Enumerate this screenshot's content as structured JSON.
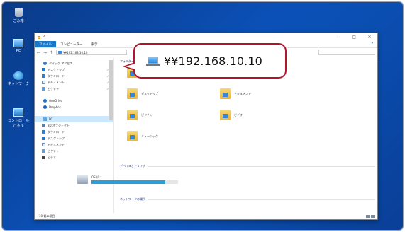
{
  "desktop": {
    "icons": [
      {
        "label": "ごみ箱",
        "icon": "recycle-bin-icon"
      },
      {
        "label": "PC",
        "icon": "pc-icon"
      },
      {
        "label": "ネットワーク",
        "icon": "network-icon"
      },
      {
        "label": "コントロールパネル",
        "icon": "control-panel-icon"
      }
    ]
  },
  "explorer": {
    "window_title": "PC",
    "window_buttons": [
      "—",
      "□",
      "×"
    ],
    "ribbon_tabs": [
      "ファイル",
      "コンピューター",
      "表示"
    ],
    "address_path": "¥¥192.168.10.10",
    "sidebar": [
      {
        "label": "クイック アクセス",
        "icon": "star-icon",
        "head": true
      },
      {
        "label": "デスクトップ",
        "icon": "desktop-icon",
        "pinned": true
      },
      {
        "label": "ダウンロード",
        "icon": "download-icon",
        "pinned": true
      },
      {
        "label": "ドキュメント",
        "icon": "documents-icon",
        "pinned": true
      },
      {
        "label": "ピクチャ",
        "icon": "pictures-icon",
        "pinned": true
      },
      {
        "label": "OneDrive",
        "icon": "onedrive-icon",
        "head": true
      },
      {
        "label": "Dropbox",
        "icon": "dropbox-icon",
        "head": true
      },
      {
        "label": "PC",
        "icon": "pc-icon",
        "head": true,
        "selected": true
      },
      {
        "label": "3D オブジェクト",
        "icon": "3d-objects-icon"
      },
      {
        "label": "ダウンロード",
        "icon": "download-icon"
      },
      {
        "label": "デスクトップ",
        "icon": "desktop-icon"
      },
      {
        "label": "ドキュメント",
        "icon": "documents-icon"
      },
      {
        "label": "ピクチャ",
        "icon": "pictures-icon"
      },
      {
        "label": "ビデオ",
        "icon": "videos-icon"
      }
    ],
    "groups": {
      "folders": "フォルダー",
      "drives": "デバイスとドライブ",
      "network": "ネットワークの場所"
    },
    "folders": [
      {
        "label": "3D オブジェクト"
      },
      {
        "label": "ダウンロード"
      },
      {
        "label": "デスクトップ"
      },
      {
        "label": "ドキュメント"
      },
      {
        "label": "ピクチャ"
      },
      {
        "label": "ビデオ"
      },
      {
        "label": "ミュージック"
      }
    ],
    "drive": {
      "label": "OS (C:)",
      "used_fraction": 0.85
    },
    "status": "10 個の項目"
  },
  "callout": {
    "path": "¥¥192.168.10.10",
    "icon": "network-computer-icon",
    "border_color": "#b1152c"
  }
}
